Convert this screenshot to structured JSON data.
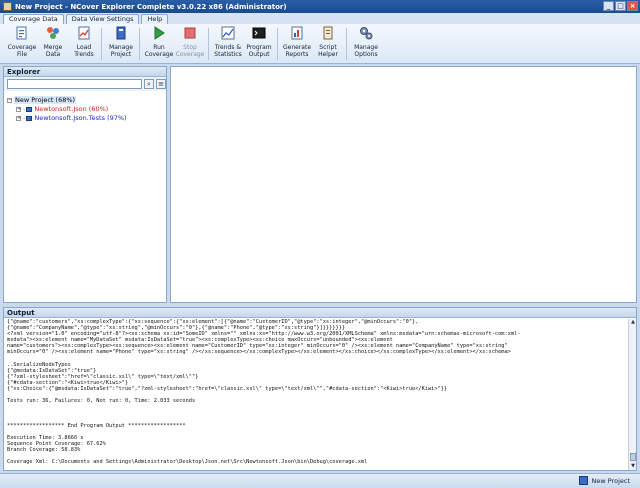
{
  "window": {
    "title": "New Project - NCover Explorer Complete v3.0.22 x86 (Administrator)"
  },
  "tabs": [
    {
      "label": "Coverage Data"
    },
    {
      "label": "Data View Settings"
    },
    {
      "label": "Help"
    }
  ],
  "toolbar": [
    {
      "label": "Coverage\nFile",
      "icon": "coverage-file-icon"
    },
    {
      "label": "Merge\nData",
      "icon": "merge-data-icon"
    },
    {
      "label": "Load\nTrends",
      "icon": "load-trends-icon"
    },
    {
      "label": "Manage\nProject",
      "icon": "manage-project-icon"
    },
    {
      "label": "Run\nCoverage",
      "icon": "run-icon"
    },
    {
      "label": "Stop\nCoverage",
      "icon": "stop-icon"
    },
    {
      "label": "Trends &\nStatistics",
      "icon": "trends-statistics-icon"
    },
    {
      "label": "Program\nOutput",
      "icon": "program-output-icon"
    },
    {
      "label": "Generate\nReports",
      "icon": "generate-reports-icon"
    },
    {
      "label": "Script\nHelper",
      "icon": "script-helper-icon"
    },
    {
      "label": "Manage\nOptions",
      "icon": "manage-options-icon"
    }
  ],
  "explorer": {
    "title": "Explorer",
    "search_value": "",
    "tree": [
      {
        "label": "New Project (68%)",
        "color": "#000000"
      },
      {
        "label": "Newtonsoft.Json (60%)",
        "color": "#d02020"
      },
      {
        "label": "Newtonsoft.Json.Tests (97%)",
        "color": "#1a28c8"
      }
    ]
  },
  "output": {
    "title": "Output",
    "lines": [
      "{\"@name\":\"customers\",\"xs:complexType\":{\"xs:sequence\":{\"xs:element\":[{\"@name\":\"CustomerID\",\"@type\":\"xs:integer\",\"@minOccurs\":\"0\"},",
      "{\"@name\":\"CompanyName\",\"@type\":\"xs:string\",\"@minOccurs\":\"0\"},{\"@name\":\"Phone\",\"@type\":\"xs:string\"}]}}}}}}}",
      "<?xml version=\"1.0\" encoding=\"utf-8\"?><xs:schema xs:id=\"SomeID\" xmlns=\"\" xmlns:xs=\"http://www.w3.org/2001/XMLSchema\" xmlns:msdata=\"urn:schemas-microsoft-com:xml-",
      "msdata\"><xs:element name=\"MyDataSet\" msdata:IsDataSet=\"true\"><xs:complexType><xs:choice maxOccurs=\"unbounded\"><xs:element",
      "name=\"customers\"><xs:complexType><xs:sequence><xs:element name=\"CustomerID\" type=\"xs:integer\" minOccurs=\"0\" /><xs:element name=\"CompanyName\" type=\"xs:string\"",
      "minOccurs=\"0\" /><xs:element name=\"Phone\" type=\"xs:string\" /></xs:sequence></xs:complexType></xs:element></xs:choice></xs:complexType></xs:element></xs:schema>",
      "",
      "..SerializeNodeTypes",
      "{\"@msdata:IsDataSet\":\"true\"}",
      "{\"?xml-stylesheet\":\"href=\\\"classic.xsl\\\" type=\\\"text/xml\\\"\"}",
      "{\"#cdata-section\":\"<Kiwi>true</Kiwi>\"}",
      "{\"xs:Choice\":{\"@msdata:IsDataSet\":\"true\",\"?xml-stylesheet\":\"href=\\\"classic.xsl\\\" type=\\\"text/xml\\\"\",\"#cdata-section\":\"<Kiwi>true</Kiwi>\"}}",
      "",
      "Tests run: 36, Failures: 0, Not run: 0, Time: 2.033 seconds",
      "",
      "",
      "",
      "****************** End Program Output ******************",
      "",
      "Execution Time: 3.8666 s",
      "Sequence Point Coverage: 67.62%",
      "Branch Coverage: 58.83%",
      "",
      "Coverage Xml: C:\\Documents and Settings\\Administrator\\Desktop\\Json.net\\Src\\Newtonsoft.Json\\bin\\Debug\\coverage.xml"
    ]
  },
  "status": {
    "project": "New Project"
  }
}
